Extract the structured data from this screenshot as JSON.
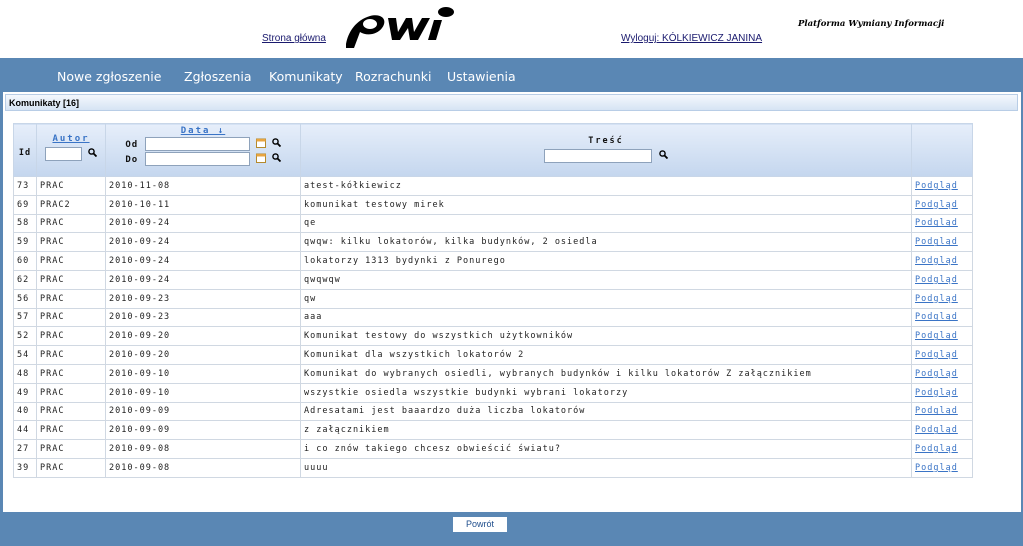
{
  "header": {
    "home_link": "Strona główna",
    "logo_text": "pwi",
    "logo_tagline": "Platforma Wymiany Informacji",
    "logout_link": "Wyloguj: KÓLKIEWICZ JANINA"
  },
  "nav": {
    "items": [
      "Nowe zgłoszenie",
      "Zgłoszenia",
      "Komunikaty",
      "Rozrachunki",
      "Ustawienia"
    ]
  },
  "panel": {
    "title": "Komunikaty [16]"
  },
  "table": {
    "headers": {
      "id": "Id",
      "autor": "Autor",
      "data": "Data ↓",
      "od": "Od",
      "do": "Do",
      "tresc": "Treść"
    },
    "rows": [
      {
        "id": "73",
        "autor": "PRAC",
        "data": "2010-11-08",
        "tresc": "atest-kółkiewicz",
        "link": "Podgląd"
      },
      {
        "id": "69",
        "autor": "PRAC2",
        "data": "2010-10-11",
        "tresc": "komunikat testowy mirek",
        "link": "Podgląd"
      },
      {
        "id": "58",
        "autor": "PRAC",
        "data": "2010-09-24",
        "tresc": "qe",
        "link": "Podgląd"
      },
      {
        "id": "59",
        "autor": "PRAC",
        "data": "2010-09-24",
        "tresc": "qwqw: kilku lokatorów, kilka budynków, 2 osiedla",
        "link": "Podgląd"
      },
      {
        "id": "60",
        "autor": "PRAC",
        "data": "2010-09-24",
        "tresc": "lokatorzy 1313 bydynki z Ponurego",
        "link": "Podgląd"
      },
      {
        "id": "62",
        "autor": "PRAC",
        "data": "2010-09-24",
        "tresc": "qwqwqw",
        "link": "Podgląd"
      },
      {
        "id": "56",
        "autor": "PRAC",
        "data": "2010-09-23",
        "tresc": "qw",
        "link": "Podgląd"
      },
      {
        "id": "57",
        "autor": "PRAC",
        "data": "2010-09-23",
        "tresc": "aaa",
        "link": "Podgląd"
      },
      {
        "id": "52",
        "autor": "PRAC",
        "data": "2010-09-20",
        "tresc": "Komunikat testowy do wszystkich użytkowników",
        "link": "Podgląd"
      },
      {
        "id": "54",
        "autor": "PRAC",
        "data": "2010-09-20",
        "tresc": "Komunikat dla wszystkich lokatorów 2",
        "link": "Podgląd"
      },
      {
        "id": "48",
        "autor": "PRAC",
        "data": "2010-09-10",
        "tresc": "Komunikat do wybranych osiedli, wybranych budynków i kilku lokatorów Z załącznikiem",
        "link": "Podgląd"
      },
      {
        "id": "49",
        "autor": "PRAC",
        "data": "2010-09-10",
        "tresc": "wszystkie osiedla wszystkie budynki wybrani lokatorzy",
        "link": "Podgląd"
      },
      {
        "id": "40",
        "autor": "PRAC",
        "data": "2010-09-09",
        "tresc": "Adresatami jest baaardzo duża liczba lokatorów",
        "link": "Podgląd"
      },
      {
        "id": "44",
        "autor": "PRAC",
        "data": "2010-09-09",
        "tresc": "z załącznikiem",
        "link": "Podgląd"
      },
      {
        "id": "27",
        "autor": "PRAC",
        "data": "2010-09-08",
        "tresc": "i co znów takiego chcesz obwieścić światu?",
        "link": "Podgląd"
      },
      {
        "id": "39",
        "autor": "PRAC",
        "data": "2010-09-08",
        "tresc": "uuuu",
        "link": "Podgląd"
      }
    ]
  },
  "footer": {
    "back_button": "Powrót"
  },
  "colors": {
    "page_background": "#5a87b4",
    "link": "#3a74c6",
    "header_gradient_top": "#e6eefa",
    "header_gradient_bottom": "#c4d6ee"
  }
}
